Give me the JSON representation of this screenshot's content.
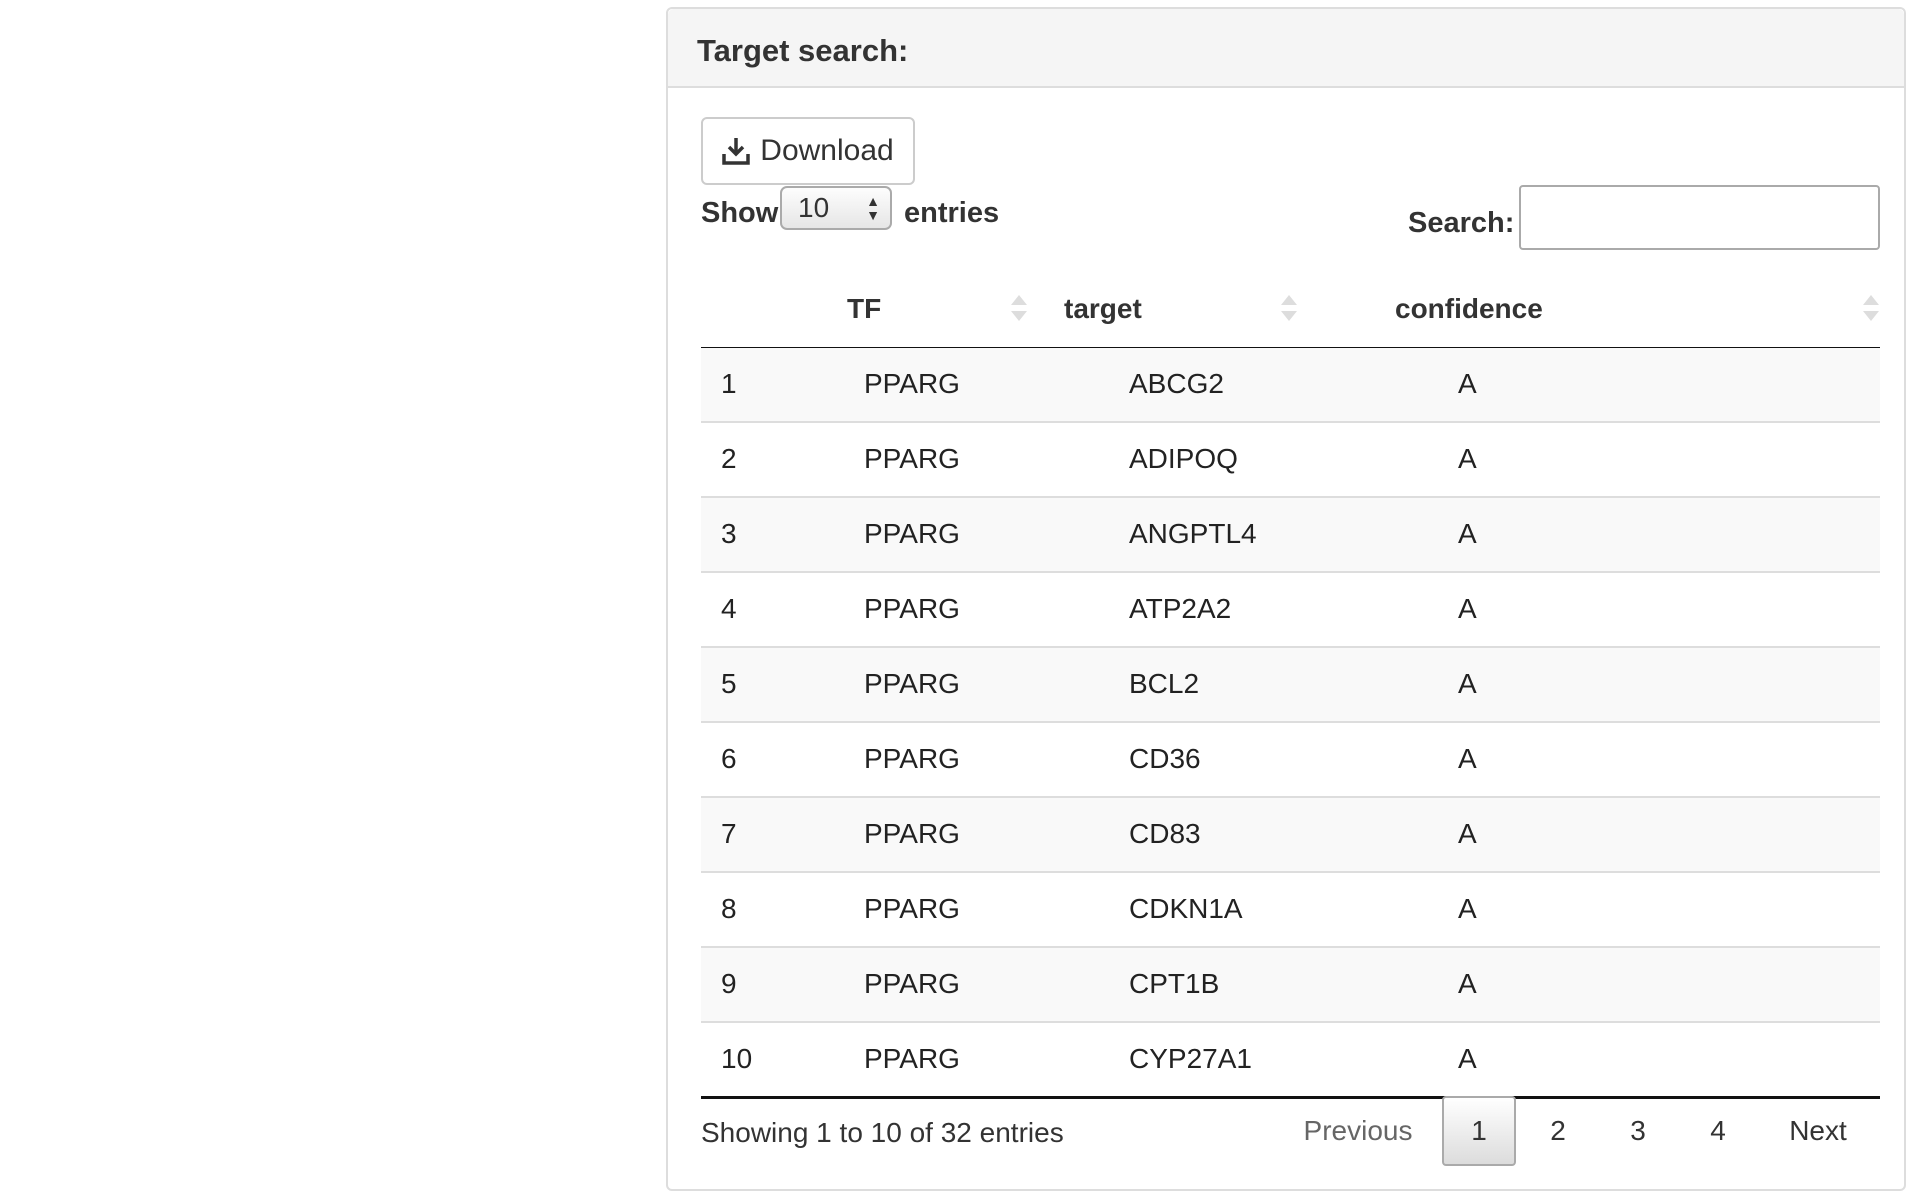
{
  "panel": {
    "title": "Target search:"
  },
  "toolbar": {
    "download_label": "Download"
  },
  "length": {
    "show_label": "Show",
    "value": "10",
    "entries_label": "entries"
  },
  "search": {
    "label": "Search:",
    "value": ""
  },
  "table": {
    "columns": [
      "",
      "TF",
      "target",
      "confidence"
    ],
    "rows": [
      [
        "1",
        "PPARG",
        "ABCG2",
        "A"
      ],
      [
        "2",
        "PPARG",
        "ADIPOQ",
        "A"
      ],
      [
        "3",
        "PPARG",
        "ANGPTL4",
        "A"
      ],
      [
        "4",
        "PPARG",
        "ATP2A2",
        "A"
      ],
      [
        "5",
        "PPARG",
        "BCL2",
        "A"
      ],
      [
        "6",
        "PPARG",
        "CD36",
        "A"
      ],
      [
        "7",
        "PPARG",
        "CD83",
        "A"
      ],
      [
        "8",
        "PPARG",
        "CDKN1A",
        "A"
      ],
      [
        "9",
        "PPARG",
        "CPT1B",
        "A"
      ],
      [
        "10",
        "PPARG",
        "CYP27A1",
        "A"
      ]
    ]
  },
  "footer": {
    "info": "Showing 1 to 10 of 32 entries",
    "pagination": {
      "previous": "Previous",
      "pages": [
        "1",
        "2",
        "3",
        "4"
      ],
      "next": "Next",
      "current": "1"
    }
  }
}
